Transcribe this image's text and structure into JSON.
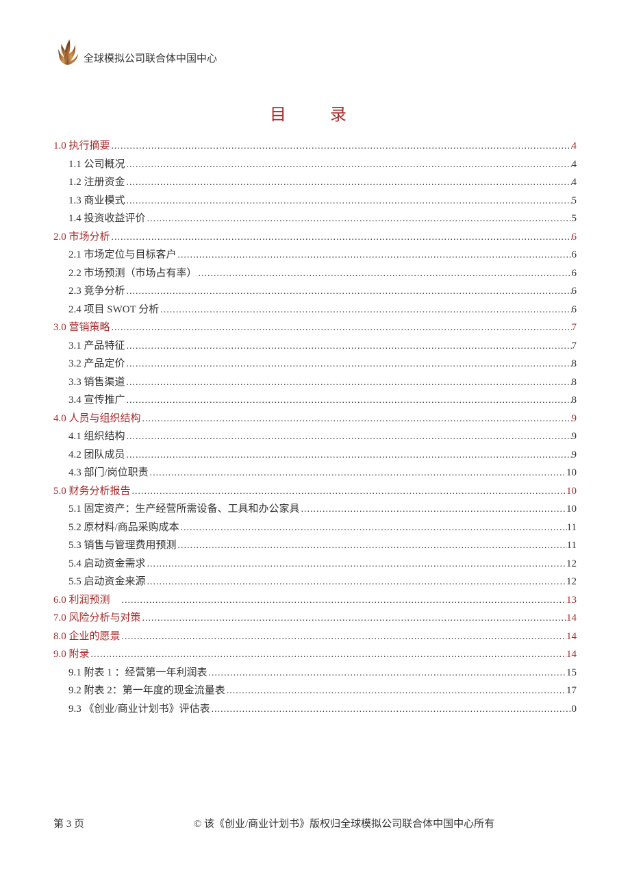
{
  "header": {
    "org_name": "全球模拟公司联合体中国中心"
  },
  "title": "目　录",
  "toc": [
    {
      "level": 0,
      "label": "1.0 执行摘要",
      "page": "4",
      "section": true
    },
    {
      "level": 1,
      "label": "1.1 公司概况",
      "page": "4",
      "section": false
    },
    {
      "level": 1,
      "label": "1.2 注册资金",
      "page": "4",
      "section": false
    },
    {
      "level": 1,
      "label": "1.3 商业模式",
      "page": "5",
      "section": false
    },
    {
      "level": 1,
      "label": "1.4 投资收益评价",
      "page": "5",
      "section": false
    },
    {
      "level": 0,
      "label": "2.0 市场分析",
      "page": "6",
      "section": true
    },
    {
      "level": 1,
      "label": "2.1 市场定位与目标客户",
      "page": "6",
      "section": false
    },
    {
      "level": 1,
      "label": "2.2 市场预测（市场占有率）",
      "page": "6",
      "section": false
    },
    {
      "level": 1,
      "label": "2.3 竞争分析",
      "page": "6",
      "section": false
    },
    {
      "level": 1,
      "label": "2.4 项目 SWOT 分析",
      "page": "6",
      "section": false
    },
    {
      "level": 0,
      "label": "3.0  营销策略",
      "page": "7",
      "section": true
    },
    {
      "level": 1,
      "label": "3.1 产品特征",
      "page": "7",
      "section": false
    },
    {
      "level": 1,
      "label": "3.2 产品定价",
      "page": "8",
      "section": false
    },
    {
      "level": 1,
      "label": "3.3 销售渠道",
      "page": "8",
      "section": false
    },
    {
      "level": 1,
      "label": "3.4 宣传推广",
      "page": "8",
      "section": false
    },
    {
      "level": 0,
      "label": "4.0 人员与组织结构",
      "page": "9",
      "section": true
    },
    {
      "level": 1,
      "label": "4.1 组织结构",
      "page": "9",
      "section": false
    },
    {
      "level": 1,
      "label": "4.2 团队成员",
      "page": "9",
      "section": false
    },
    {
      "level": 1,
      "label": "4.3 部门/岗位职责",
      "page": "10",
      "section": false
    },
    {
      "level": 0,
      "label": "5.0 财务分析报告",
      "page": "10",
      "section": true
    },
    {
      "level": 1,
      "label": "5.1 固定资产：生产经营所需设备、工具和办公家具",
      "page": "10",
      "section": false
    },
    {
      "level": 1,
      "label": "5.2 原材料/商品采购成本",
      "page": "11",
      "section": false
    },
    {
      "level": 1,
      "label": "5.3 销售与管理费用预测",
      "page": "11",
      "section": false
    },
    {
      "level": 1,
      "label": "5.4 启动资金需求",
      "page": "12",
      "section": false
    },
    {
      "level": 1,
      "label": "5.5 启动资金来源",
      "page": "12",
      "section": false
    },
    {
      "level": 0,
      "label": "6.0 利润预测　",
      "page": "13",
      "section": true
    },
    {
      "level": 0,
      "label": "7.0 风险分析与对策",
      "page": "14",
      "section": true
    },
    {
      "level": 0,
      "label": "8.0 企业的愿景",
      "page": "14",
      "section": true
    },
    {
      "level": 0,
      "label": "9.0 附录",
      "page": "14",
      "section": true
    },
    {
      "level": 1,
      "label": "9.1 附表 1 ：经营第一年利润表",
      "page": "15",
      "section": false
    },
    {
      "level": 1,
      "label": "9.2  附表 2：第一年度的现金流量表",
      "page": "17",
      "section": false
    },
    {
      "level": 1,
      "label": "9.3 《创业/商业计划书》评估表",
      "page": "0",
      "section": false
    }
  ],
  "footer": {
    "page_label": "第 3 页",
    "copyright": "© 该《创业/商业计划书》版权归全球模拟公司联合体中国中心所有"
  }
}
